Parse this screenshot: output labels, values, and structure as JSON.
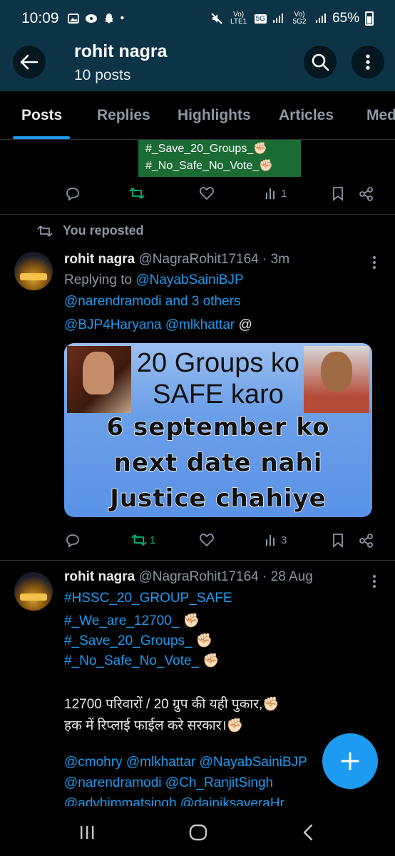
{
  "status_bar": {
    "time": "10:09",
    "volte1": "Vo) LTE1",
    "net": "5G",
    "volte2": "Vo) 5G2",
    "battery": "65%"
  },
  "header": {
    "title": "rohit nagra",
    "subtitle": "10 posts"
  },
  "tabs": [
    "Posts",
    "Replies",
    "Highlights",
    "Articles",
    "Med"
  ],
  "top_post": {
    "hashtag1": "#_Save_20_Groups_✊🏻",
    "hashtag2": "#_No_Safe_No_Vote_✊🏻",
    "views": "1"
  },
  "repost_label": "You reposted",
  "post1": {
    "name": "rohit nagra",
    "handle_time": "@NagraRohit17164 · 3m",
    "replying_prefix": "Replying to ",
    "replying_to": "@NayabSainiBJP",
    "mentions_line": "@narendramodi and 3 others",
    "mention_a": "@BJP4Haryana",
    "mention_b": "@mlkhattar",
    "mention_c": "@",
    "image": {
      "line1": "20 Groups ko",
      "line2": "SAFE karo",
      "line3": "6 september ko",
      "line4": "next date nahi",
      "line5": "Justice chahiye"
    },
    "reposts": "1",
    "views": "3"
  },
  "post2": {
    "name": "rohit nagra",
    "handle_time": "@NagraRohit17164 · 28 Aug",
    "tag1": "#HSSC_20_GROUP_SAFE",
    "tag2": "#_We_are_12700_",
    "tag3": "#_Save_20_Groups_",
    "tag4": "#_No_Safe_No_Vote_",
    "hindi1": "12700 परिवारों / 20 ग्रुप की यही पुकार,✊🏻",
    "hindi2": "हक में रिप्लाई फाईल करे सरकार।✊🏻",
    "mentions1": "@cmohry @mlkhattar @NayabSainiBJP",
    "mentions2": "@narendramodi @Ch_RanjitSingh",
    "mentions3": "@advhimmatsingh @dainiksaveraHr"
  },
  "colors": {
    "header_bg": "#0d3446",
    "accent": "#1d9bf0",
    "repost_green": "#00ba7c",
    "hashtag_box": "#1b6b34"
  }
}
